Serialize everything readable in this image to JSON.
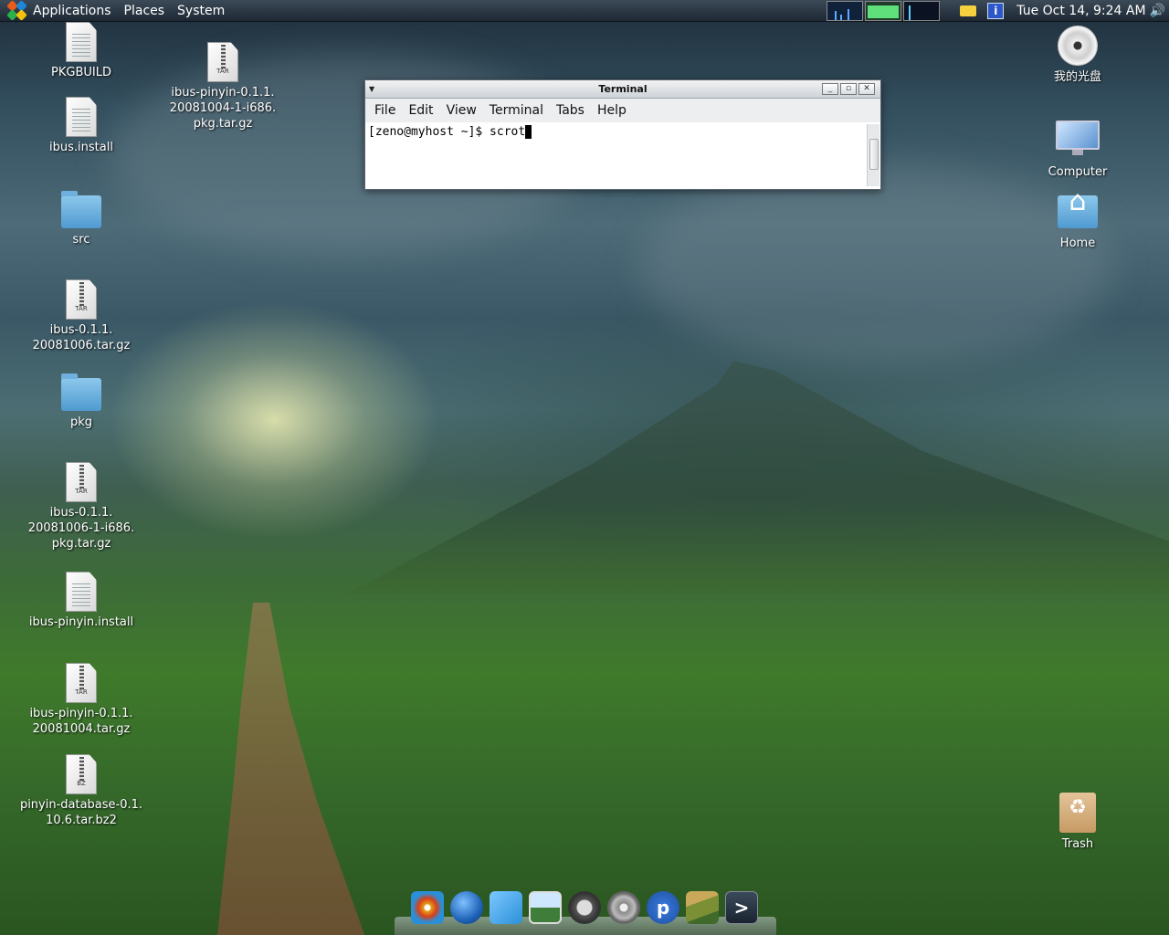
{
  "panel": {
    "menus": [
      "Applications",
      "Places",
      "System"
    ],
    "clock": "Tue Oct 14,  9:24 AM"
  },
  "desktop": {
    "left_icons": [
      {
        "label": "PKGBUILD",
        "type": "text-file",
        "icon": "text-file-icon"
      },
      {
        "label": "ibus.install",
        "type": "text-file",
        "icon": "text-file-icon"
      },
      {
        "label": "src",
        "type": "folder",
        "icon": "folder-icon"
      },
      {
        "label": "ibus-0.1.1.\n20081006.tar.gz",
        "type": "archive",
        "tag": "TAR",
        "icon": "tar-archive-icon"
      },
      {
        "label": "pkg",
        "type": "folder",
        "icon": "folder-icon"
      },
      {
        "label": "ibus-0.1.1.\n20081006-1-i686.\npkg.tar.gz",
        "type": "archive",
        "tag": "TAR",
        "icon": "tar-archive-icon"
      },
      {
        "label": "ibus-pinyin.install",
        "type": "text-file",
        "icon": "text-file-icon"
      },
      {
        "label": "ibus-pinyin-0.1.1.\n20081004.tar.gz",
        "type": "archive",
        "tag": "TAR",
        "icon": "tar-archive-icon"
      },
      {
        "label": "pinyin-database-0.1.\n10.6.tar.bz2",
        "type": "archive",
        "tag": "BZ",
        "icon": "bz2-archive-icon"
      }
    ],
    "second_column_icons": [
      {
        "label": "ibus-pinyin-0.1.1.\n20081004-1-i686.\npkg.tar.gz",
        "type": "archive",
        "tag": "TAR",
        "icon": "tar-archive-icon"
      }
    ],
    "right_icons": [
      {
        "label": "我的光盘",
        "icon": "cd-icon"
      },
      {
        "label": "Computer",
        "icon": "computer-icon"
      },
      {
        "label": "Home",
        "icon": "home-folder-icon"
      },
      {
        "label": "Trash",
        "icon": "trash-icon"
      }
    ]
  },
  "terminal": {
    "title": "Terminal",
    "menu": [
      "File",
      "Edit",
      "View",
      "Terminal",
      "Tabs",
      "Help"
    ],
    "prompt": "[zeno@myhost ~]$ scrot"
  },
  "dock": {
    "items": [
      {
        "icon": "pinwheel-icon",
        "color": "#e3a21a"
      },
      {
        "icon": "globe-icon",
        "color": "#1f63b8"
      },
      {
        "icon": "puzzle-icon",
        "color": "#2c90d8"
      },
      {
        "icon": "photo-viewer-icon",
        "color": "#4a7fb5"
      },
      {
        "icon": "headphones-icon",
        "color": "#666666"
      },
      {
        "icon": "film-reel-icon",
        "color": "#777777"
      },
      {
        "icon": "pidgin-icon",
        "color": "#1e4f9e",
        "glyph": "p"
      },
      {
        "icon": "books-icon",
        "color": "#7b8f35"
      },
      {
        "icon": "terminal-icon",
        "color": "#2a3a4a",
        "glyph": ">"
      }
    ]
  },
  "colors": {
    "panel": "#2a3642",
    "accent": "#4f9ad0"
  }
}
